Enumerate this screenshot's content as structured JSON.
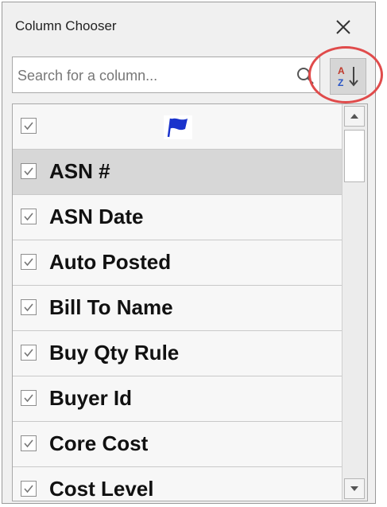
{
  "window": {
    "title": "Column Chooser",
    "close_icon": "close-icon"
  },
  "search": {
    "placeholder": "Search for a column...",
    "value": "",
    "icon": "search-icon"
  },
  "toolbar": {
    "sort_icon": "sort-az-icon"
  },
  "colors": {
    "highlight": "#e04b4b",
    "selected_row": "#d7d7d7",
    "flag": "#1a33cc"
  },
  "columns": [
    {
      "label": "",
      "checked": true,
      "icon": "flag-icon"
    },
    {
      "label": "ASN #",
      "checked": true,
      "selected": true
    },
    {
      "label": "ASN Date",
      "checked": true
    },
    {
      "label": "Auto Posted",
      "checked": true
    },
    {
      "label": "Bill To Name",
      "checked": true
    },
    {
      "label": "Buy Qty Rule",
      "checked": true
    },
    {
      "label": "Buyer Id",
      "checked": true
    },
    {
      "label": "Core Cost",
      "checked": true
    },
    {
      "label": "Cost Level",
      "checked": true
    }
  ]
}
